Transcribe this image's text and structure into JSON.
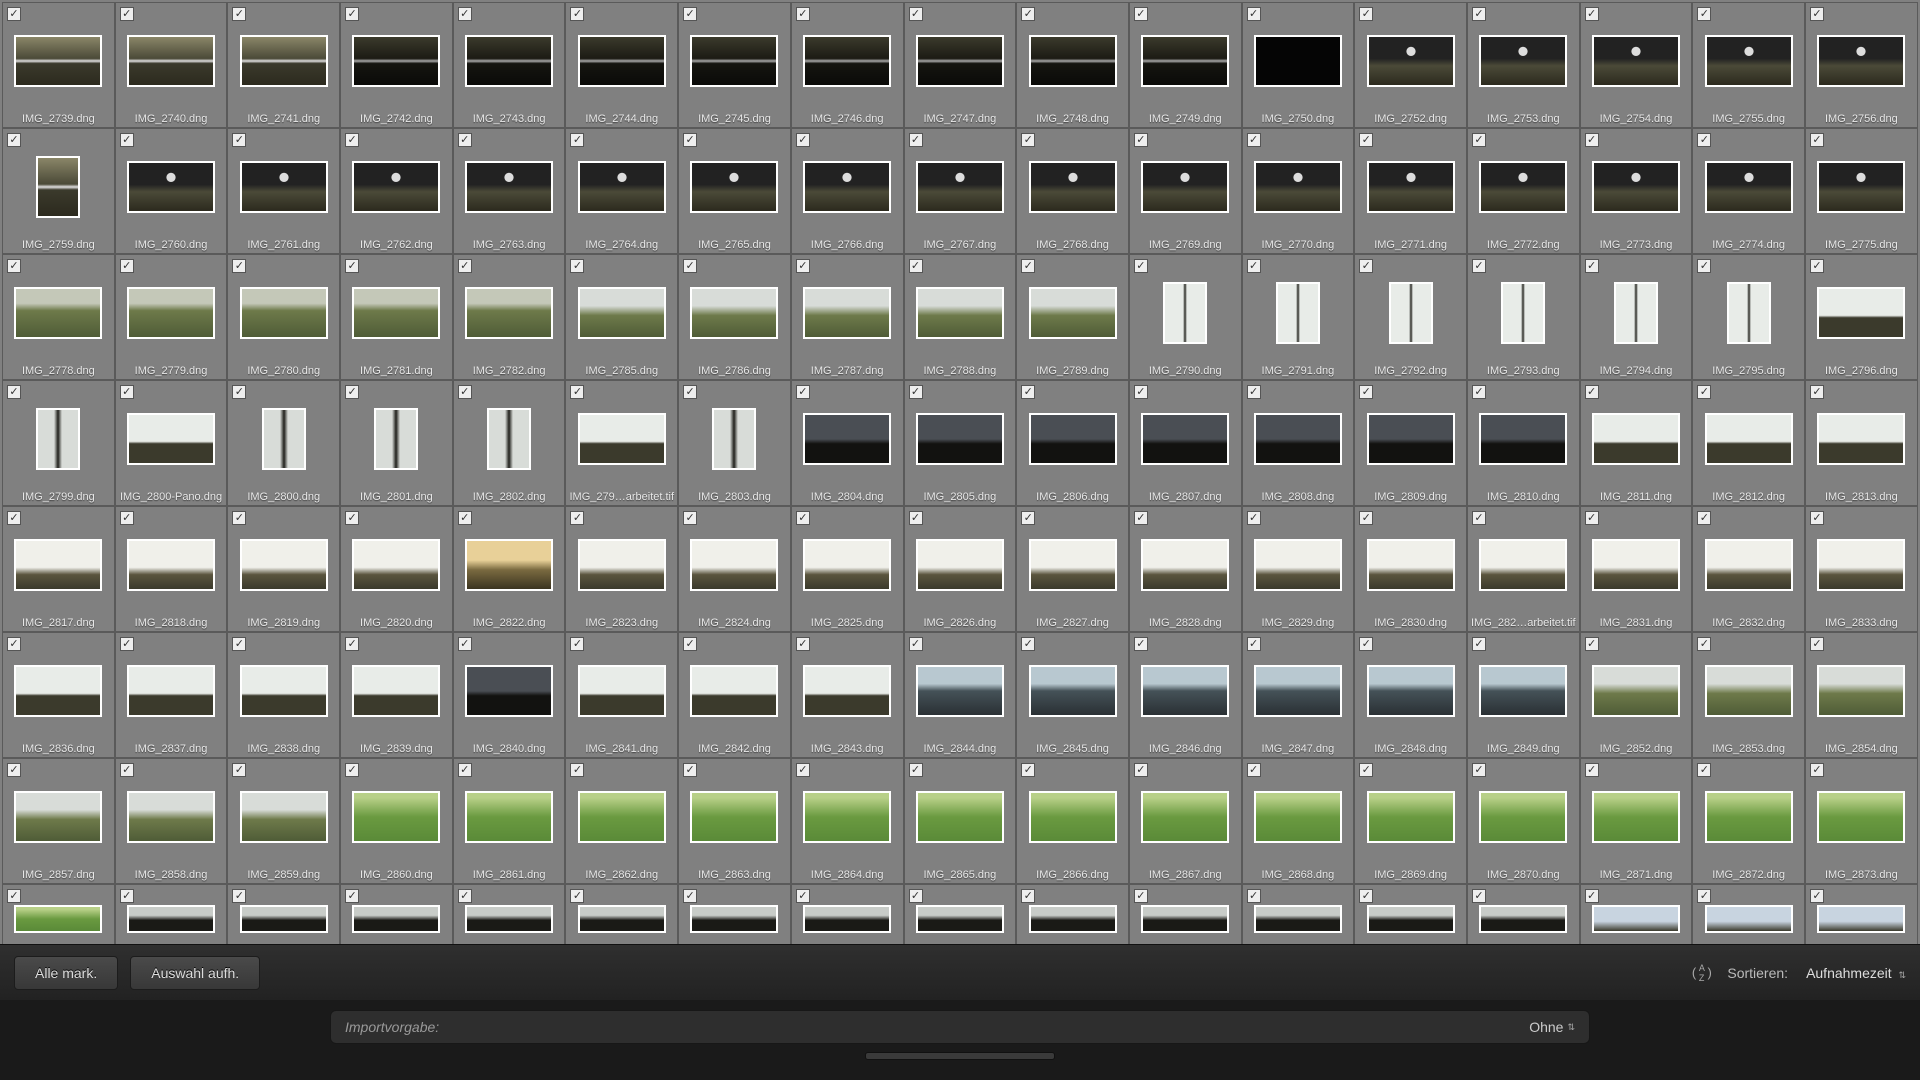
{
  "toolbar": {
    "select_all": "Alle mark.",
    "deselect_all": "Auswahl aufh.",
    "sort_label": "Sortieren:",
    "sort_value": "Aufnahmezeit"
  },
  "preset": {
    "label": "Importvorgabe:",
    "value": "Ohne"
  },
  "thumbnails": [
    [
      {
        "f": "IMG_2739.dng",
        "c": true,
        "t": "t-wfall",
        "o": "l"
      },
      {
        "f": "IMG_2740.dng",
        "c": true,
        "t": "t-wfall",
        "o": "l"
      },
      {
        "f": "IMG_2741.dng",
        "c": true,
        "t": "t-wfall",
        "o": "l"
      },
      {
        "f": "IMG_2742.dng",
        "c": true,
        "t": "t-wfdark",
        "o": "l"
      },
      {
        "f": "IMG_2743.dng",
        "c": true,
        "t": "t-wfdark",
        "o": "l"
      },
      {
        "f": "IMG_2744.dng",
        "c": true,
        "t": "t-wfdark",
        "o": "l"
      },
      {
        "f": "IMG_2745.dng",
        "c": true,
        "t": "t-wfdark",
        "o": "l"
      },
      {
        "f": "IMG_2746.dng",
        "c": true,
        "t": "t-wfdark",
        "o": "l"
      },
      {
        "f": "IMG_2747.dng",
        "c": true,
        "t": "t-wfdark",
        "o": "l"
      },
      {
        "f": "IMG_2748.dng",
        "c": true,
        "t": "t-wfdark",
        "o": "l"
      },
      {
        "f": "IMG_2749.dng",
        "c": true,
        "t": "t-wfdark",
        "o": "l"
      },
      {
        "f": "IMG_2750.dng",
        "c": true,
        "t": "t-black",
        "o": "l"
      },
      {
        "f": "IMG_2752.dng",
        "c": true,
        "t": "t-valley",
        "o": "l"
      },
      {
        "f": "IMG_2753.dng",
        "c": true,
        "t": "t-valley",
        "o": "l"
      },
      {
        "f": "IMG_2754.dng",
        "c": true,
        "t": "t-valley",
        "o": "l"
      },
      {
        "f": "IMG_2755.dng",
        "c": true,
        "t": "t-valley",
        "o": "l"
      },
      {
        "f": "IMG_2756.dng",
        "c": true,
        "t": "t-valley",
        "o": "l"
      }
    ],
    [
      {
        "f": "IMG_2759.dng",
        "c": true,
        "t": "t-wfall",
        "o": "p"
      },
      {
        "f": "IMG_2760.dng",
        "c": true,
        "t": "t-valley",
        "o": "l"
      },
      {
        "f": "IMG_2761.dng",
        "c": true,
        "t": "t-valley",
        "o": "l"
      },
      {
        "f": "IMG_2762.dng",
        "c": true,
        "t": "t-valley",
        "o": "l"
      },
      {
        "f": "IMG_2763.dng",
        "c": true,
        "t": "t-valley",
        "o": "l"
      },
      {
        "f": "IMG_2764.dng",
        "c": true,
        "t": "t-valley",
        "o": "l"
      },
      {
        "f": "IMG_2765.dng",
        "c": true,
        "t": "t-valley",
        "o": "l"
      },
      {
        "f": "IMG_2766.dng",
        "c": true,
        "t": "t-valley",
        "o": "l"
      },
      {
        "f": "IMG_2767.dng",
        "c": true,
        "t": "t-valley",
        "o": "l"
      },
      {
        "f": "IMG_2768.dng",
        "c": true,
        "t": "t-valley",
        "o": "l"
      },
      {
        "f": "IMG_2769.dng",
        "c": true,
        "t": "t-valley",
        "o": "l"
      },
      {
        "f": "IMG_2770.dng",
        "c": true,
        "t": "t-valley",
        "o": "l"
      },
      {
        "f": "IMG_2771.dng",
        "c": true,
        "t": "t-valley",
        "o": "l"
      },
      {
        "f": "IMG_2772.dng",
        "c": true,
        "t": "t-valley",
        "o": "l"
      },
      {
        "f": "IMG_2773.dng",
        "c": true,
        "t": "t-valley",
        "o": "l"
      },
      {
        "f": "IMG_2774.dng",
        "c": true,
        "t": "t-valley",
        "o": "l"
      },
      {
        "f": "IMG_2775.dng",
        "c": true,
        "t": "t-valley",
        "o": "l"
      }
    ],
    [
      {
        "f": "IMG_2778.dng",
        "c": true,
        "t": "t-green",
        "o": "l"
      },
      {
        "f": "IMG_2779.dng",
        "c": true,
        "t": "t-green",
        "o": "l"
      },
      {
        "f": "IMG_2780.dng",
        "c": true,
        "t": "t-green",
        "o": "l"
      },
      {
        "f": "IMG_2781.dng",
        "c": true,
        "t": "t-green",
        "o": "l"
      },
      {
        "f": "IMG_2782.dng",
        "c": true,
        "t": "t-green",
        "o": "l"
      },
      {
        "f": "IMG_2785.dng",
        "c": true,
        "t": "t-coast",
        "o": "l"
      },
      {
        "f": "IMG_2786.dng",
        "c": true,
        "t": "t-coast",
        "o": "l"
      },
      {
        "f": "IMG_2787.dng",
        "c": true,
        "t": "t-coast",
        "o": "l"
      },
      {
        "f": "IMG_2788.dng",
        "c": true,
        "t": "t-coast",
        "o": "l"
      },
      {
        "f": "IMG_2789.dng",
        "c": true,
        "t": "t-coast",
        "o": "l"
      },
      {
        "f": "IMG_2790.dng",
        "c": true,
        "t": "t-cliff",
        "o": "p"
      },
      {
        "f": "IMG_2791.dng",
        "c": true,
        "t": "t-cliff",
        "o": "p"
      },
      {
        "f": "IMG_2792.dng",
        "c": true,
        "t": "t-cliff",
        "o": "p"
      },
      {
        "f": "IMG_2793.dng",
        "c": true,
        "t": "t-cliff",
        "o": "p"
      },
      {
        "f": "IMG_2794.dng",
        "c": true,
        "t": "t-cliff",
        "o": "p"
      },
      {
        "f": "IMG_2795.dng",
        "c": true,
        "t": "t-cliff",
        "o": "p"
      },
      {
        "f": "IMG_2796.dng",
        "c": true,
        "t": "t-storr",
        "o": "l"
      }
    ],
    [
      {
        "f": "IMG_2799.dng",
        "c": true,
        "t": "t-storrv",
        "o": "p"
      },
      {
        "f": "IMG_2800-Pano.dng",
        "c": true,
        "t": "t-storr",
        "o": "l"
      },
      {
        "f": "IMG_2800.dng",
        "c": true,
        "t": "t-storrv",
        "o": "p"
      },
      {
        "f": "IMG_2801.dng",
        "c": true,
        "t": "t-storrv",
        "o": "p"
      },
      {
        "f": "IMG_2802.dng",
        "c": true,
        "t": "t-storrv",
        "o": "p"
      },
      {
        "f": "IMG_279…arbeitet.tif",
        "c": true,
        "t": "t-storr",
        "o": "l"
      },
      {
        "f": "IMG_2803.dng",
        "c": true,
        "t": "t-storrv",
        "o": "p"
      },
      {
        "f": "IMG_2804.dng",
        "c": true,
        "t": "t-stdark",
        "o": "l"
      },
      {
        "f": "IMG_2805.dng",
        "c": true,
        "t": "t-stdark",
        "o": "l"
      },
      {
        "f": "IMG_2806.dng",
        "c": true,
        "t": "t-stdark",
        "o": "l"
      },
      {
        "f": "IMG_2807.dng",
        "c": true,
        "t": "t-stdark",
        "o": "l"
      },
      {
        "f": "IMG_2808.dng",
        "c": true,
        "t": "t-stdark",
        "o": "l"
      },
      {
        "f": "IMG_2809.dng",
        "c": true,
        "t": "t-stdark",
        "o": "l"
      },
      {
        "f": "IMG_2810.dng",
        "c": true,
        "t": "t-stdark",
        "o": "l"
      },
      {
        "f": "IMG_2811.dng",
        "c": true,
        "t": "t-storr",
        "o": "l"
      },
      {
        "f": "IMG_2812.dng",
        "c": true,
        "t": "t-storr",
        "o": "l"
      },
      {
        "f": "IMG_2813.dng",
        "c": true,
        "t": "t-storr",
        "o": "l"
      }
    ],
    [
      {
        "f": "IMG_2817.dng",
        "c": true,
        "t": "t-stbright",
        "o": "l"
      },
      {
        "f": "IMG_2818.dng",
        "c": true,
        "t": "t-stbright",
        "o": "l"
      },
      {
        "f": "IMG_2819.dng",
        "c": true,
        "t": "t-stbright",
        "o": "l"
      },
      {
        "f": "IMG_2820.dng",
        "c": true,
        "t": "t-stbright",
        "o": "l"
      },
      {
        "f": "IMG_2822.dng",
        "c": true,
        "t": "t-sunset",
        "o": "l"
      },
      {
        "f": "IMG_2823.dng",
        "c": true,
        "t": "t-stbright",
        "o": "l"
      },
      {
        "f": "IMG_2824.dng",
        "c": true,
        "t": "t-stbright",
        "o": "l"
      },
      {
        "f": "IMG_2825.dng",
        "c": true,
        "t": "t-stbright",
        "o": "l"
      },
      {
        "f": "IMG_2826.dng",
        "c": true,
        "t": "t-stbright",
        "o": "l"
      },
      {
        "f": "IMG_2827.dng",
        "c": true,
        "t": "t-stbright",
        "o": "l"
      },
      {
        "f": "IMG_2828.dng",
        "c": true,
        "t": "t-stbright",
        "o": "l"
      },
      {
        "f": "IMG_2829.dng",
        "c": true,
        "t": "t-stbright",
        "o": "l"
      },
      {
        "f": "IMG_2830.dng",
        "c": true,
        "t": "t-stbright",
        "o": "l"
      },
      {
        "f": "IMG_282…arbeitet.tif",
        "c": true,
        "t": "t-stbright",
        "o": "l"
      },
      {
        "f": "IMG_2831.dng",
        "c": true,
        "t": "t-stbright",
        "o": "l"
      },
      {
        "f": "IMG_2832.dng",
        "c": true,
        "t": "t-stbright",
        "o": "l"
      },
      {
        "f": "IMG_2833.dng",
        "c": true,
        "t": "t-stbright",
        "o": "l"
      }
    ],
    [
      {
        "f": "IMG_2836.dng",
        "c": true,
        "t": "t-storr",
        "o": "l"
      },
      {
        "f": "IMG_2837.dng",
        "c": true,
        "t": "t-storr",
        "o": "l"
      },
      {
        "f": "IMG_2838.dng",
        "c": true,
        "t": "t-storr",
        "o": "l"
      },
      {
        "f": "IMG_2839.dng",
        "c": true,
        "t": "t-storr",
        "o": "l"
      },
      {
        "f": "IMG_2840.dng",
        "c": true,
        "t": "t-stdark",
        "o": "l"
      },
      {
        "f": "IMG_2841.dng",
        "c": true,
        "t": "t-storr",
        "o": "l"
      },
      {
        "f": "IMG_2842.dng",
        "c": true,
        "t": "t-storr",
        "o": "l"
      },
      {
        "f": "IMG_2843.dng",
        "c": true,
        "t": "t-storr",
        "o": "l"
      },
      {
        "f": "IMG_2844.dng",
        "c": true,
        "t": "t-sea",
        "o": "l"
      },
      {
        "f": "IMG_2845.dng",
        "c": true,
        "t": "t-sea",
        "o": "l"
      },
      {
        "f": "IMG_2846.dng",
        "c": true,
        "t": "t-sea",
        "o": "l"
      },
      {
        "f": "IMG_2847.dng",
        "c": true,
        "t": "t-sea",
        "o": "l"
      },
      {
        "f": "IMG_2848.dng",
        "c": true,
        "t": "t-sea",
        "o": "l"
      },
      {
        "f": "IMG_2849.dng",
        "c": true,
        "t": "t-sea",
        "o": "l"
      },
      {
        "f": "IMG_2852.dng",
        "c": true,
        "t": "t-coast",
        "o": "l"
      },
      {
        "f": "IMG_2853.dng",
        "c": true,
        "t": "t-coast",
        "o": "l"
      },
      {
        "f": "IMG_2854.dng",
        "c": true,
        "t": "t-coast",
        "o": "l"
      }
    ],
    [
      {
        "f": "IMG_2857.dng",
        "c": true,
        "t": "t-coast",
        "o": "l"
      },
      {
        "f": "IMG_2858.dng",
        "c": true,
        "t": "t-coast",
        "o": "l"
      },
      {
        "f": "IMG_2859.dng",
        "c": true,
        "t": "t-coast",
        "o": "l"
      },
      {
        "f": "IMG_2860.dng",
        "c": true,
        "t": "t-grass",
        "o": "l"
      },
      {
        "f": "IMG_2861.dng",
        "c": true,
        "t": "t-grass",
        "o": "l"
      },
      {
        "f": "IMG_2862.dng",
        "c": true,
        "t": "t-grass",
        "o": "l"
      },
      {
        "f": "IMG_2863.dng",
        "c": true,
        "t": "t-grass",
        "o": "l"
      },
      {
        "f": "IMG_2864.dng",
        "c": true,
        "t": "t-grass",
        "o": "l"
      },
      {
        "f": "IMG_2865.dng",
        "c": true,
        "t": "t-grass",
        "o": "l"
      },
      {
        "f": "IMG_2866.dng",
        "c": true,
        "t": "t-grass",
        "o": "l"
      },
      {
        "f": "IMG_2867.dng",
        "c": true,
        "t": "t-grass",
        "o": "l"
      },
      {
        "f": "IMG_2868.dng",
        "c": true,
        "t": "t-grass",
        "o": "l"
      },
      {
        "f": "IMG_2869.dng",
        "c": true,
        "t": "t-grass",
        "o": "l"
      },
      {
        "f": "IMG_2870.dng",
        "c": true,
        "t": "t-grass",
        "o": "l"
      },
      {
        "f": "IMG_2871.dng",
        "c": true,
        "t": "t-grass",
        "o": "l"
      },
      {
        "f": "IMG_2872.dng",
        "c": true,
        "t": "t-grass",
        "o": "l"
      },
      {
        "f": "IMG_2873.dng",
        "c": true,
        "t": "t-grass",
        "o": "l"
      }
    ],
    [
      {
        "f": "",
        "c": true,
        "t": "t-grass",
        "o": "l"
      },
      {
        "f": "",
        "c": true,
        "t": "t-darkfg",
        "o": "l"
      },
      {
        "f": "",
        "c": true,
        "t": "t-darkfg",
        "o": "l"
      },
      {
        "f": "",
        "c": true,
        "t": "t-darkfg",
        "o": "l"
      },
      {
        "f": "",
        "c": true,
        "t": "t-darkfg",
        "o": "l"
      },
      {
        "f": "",
        "c": true,
        "t": "t-darkfg",
        "o": "l"
      },
      {
        "f": "",
        "c": true,
        "t": "t-darkfg",
        "o": "l"
      },
      {
        "f": "",
        "c": true,
        "t": "t-darkfg",
        "o": "l"
      },
      {
        "f": "",
        "c": true,
        "t": "t-darkfg",
        "o": "l"
      },
      {
        "f": "",
        "c": true,
        "t": "t-darkfg",
        "o": "l"
      },
      {
        "f": "",
        "c": true,
        "t": "t-darkfg",
        "o": "l"
      },
      {
        "f": "",
        "c": true,
        "t": "t-darkfg",
        "o": "l"
      },
      {
        "f": "",
        "c": true,
        "t": "t-darkfg",
        "o": "l"
      },
      {
        "f": "",
        "c": true,
        "t": "t-darkfg",
        "o": "l"
      },
      {
        "f": "",
        "c": true,
        "t": "t-sky",
        "o": "l"
      },
      {
        "f": "",
        "c": true,
        "t": "t-sky",
        "o": "l"
      },
      {
        "f": "",
        "c": true,
        "t": "t-sky",
        "o": "l"
      }
    ]
  ]
}
